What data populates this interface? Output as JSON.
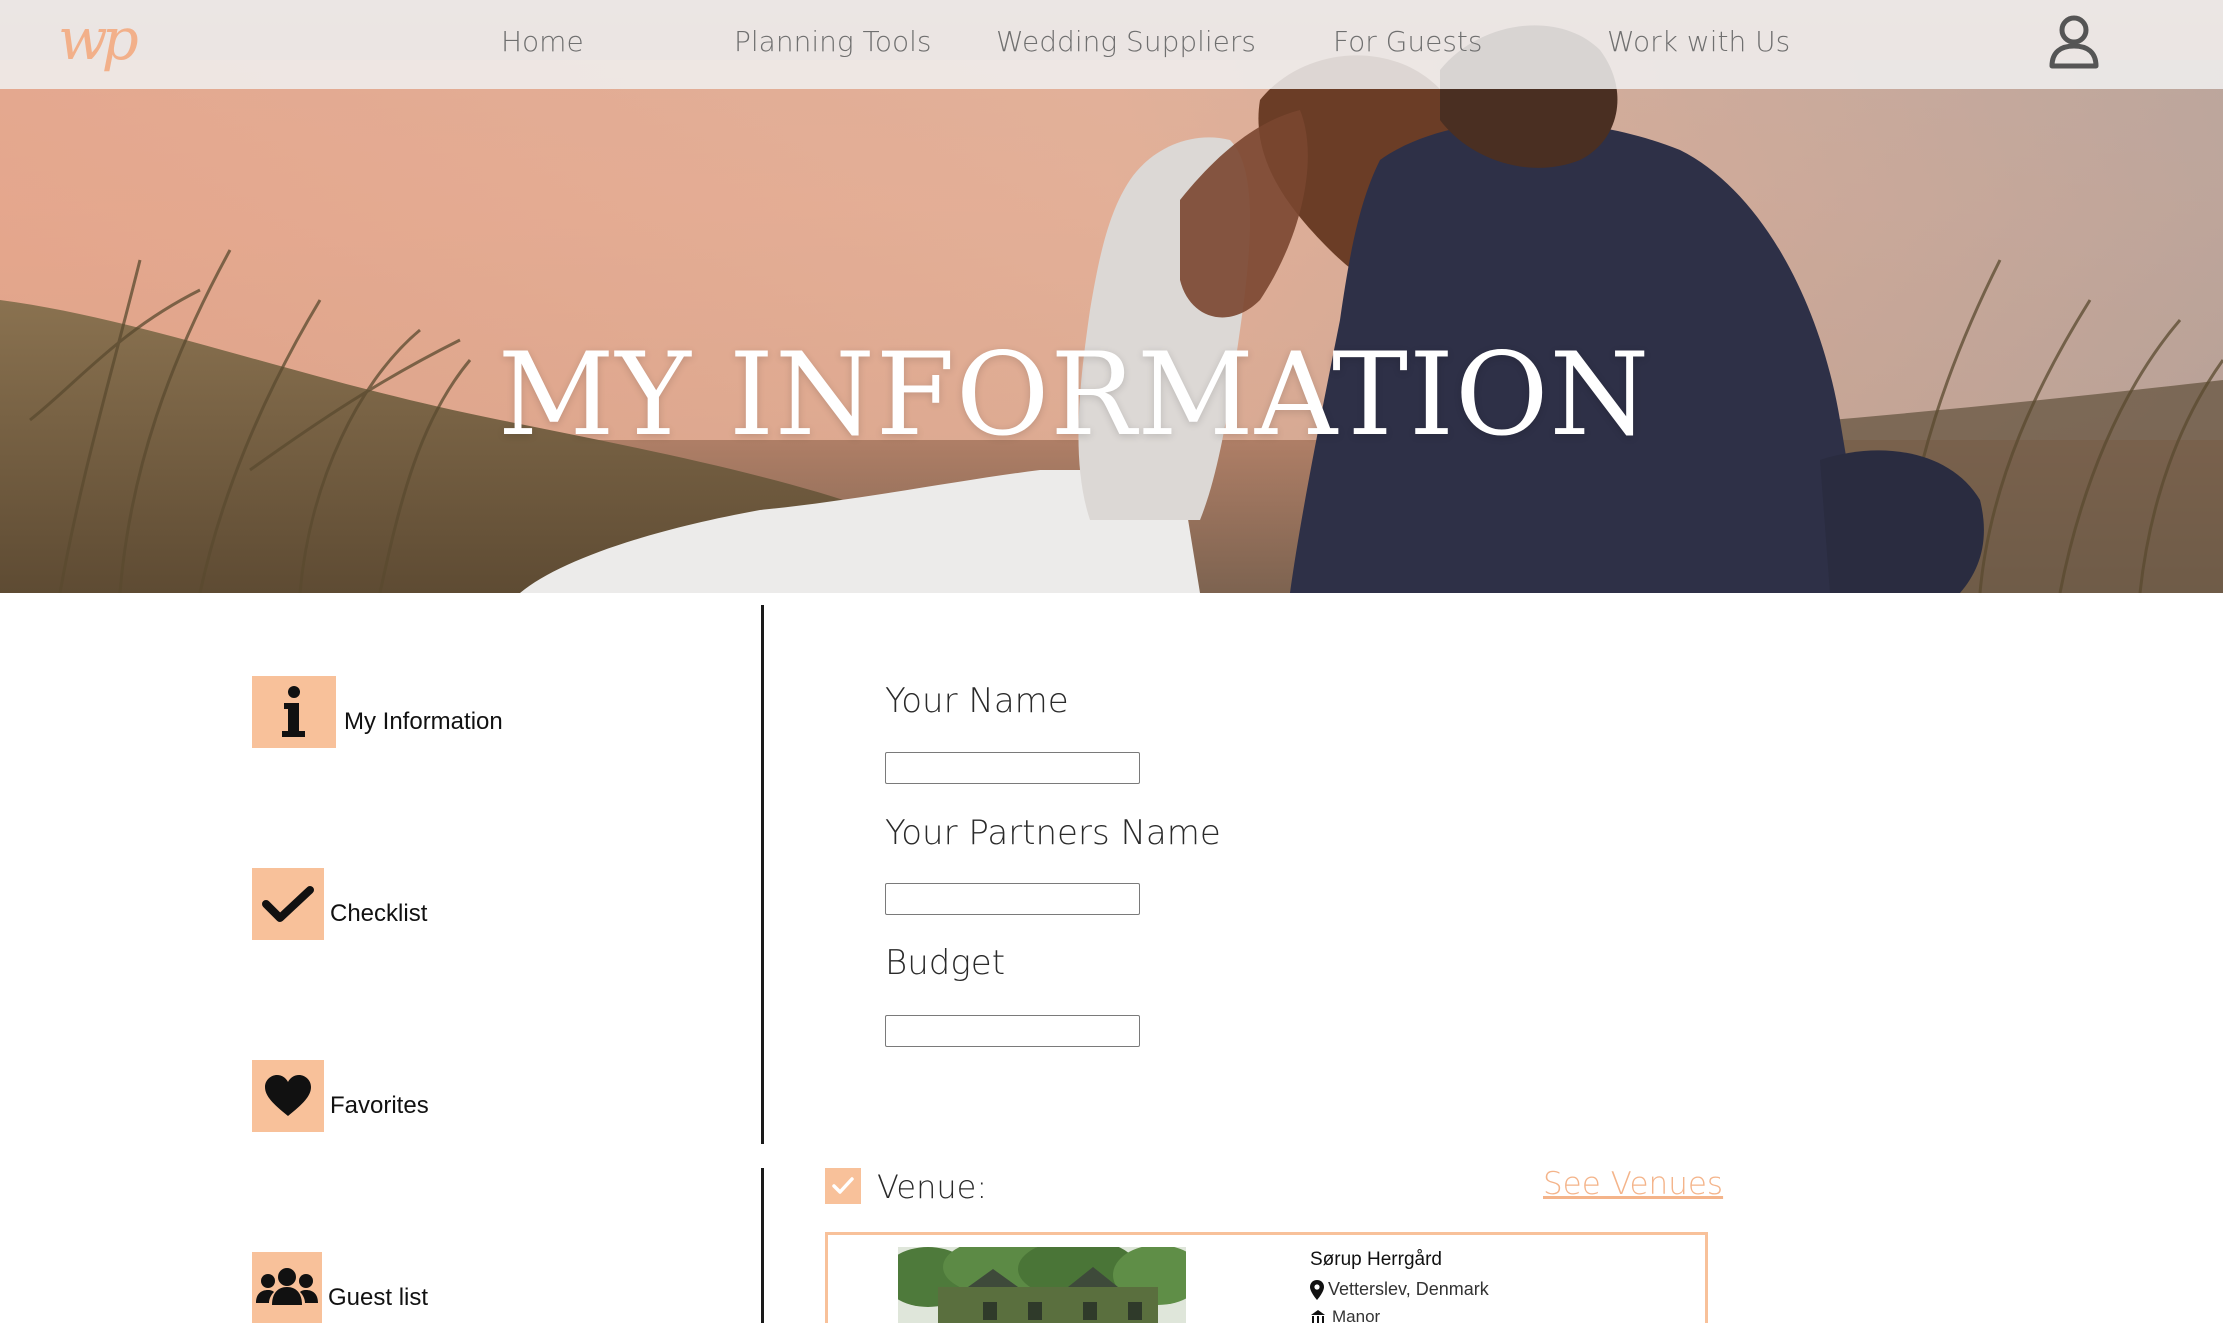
{
  "brand": {
    "logo_text": "wp",
    "accent_color": "#f8c19a"
  },
  "nav": {
    "items": [
      {
        "label": "Home"
      },
      {
        "label": "Planning Tools"
      },
      {
        "label": "Wedding Suppliers"
      },
      {
        "label": "For Guests"
      },
      {
        "label": "Work with Us"
      }
    ],
    "user_icon": "user-icon"
  },
  "hero": {
    "title": "MY INFORMATION"
  },
  "sidebar": {
    "items": [
      {
        "label": "My Information",
        "icon": "info-icon"
      },
      {
        "label": "Checklist",
        "icon": "checkmark-icon"
      },
      {
        "label": "Favorites",
        "icon": "heart-icon"
      },
      {
        "label": "Guest list",
        "icon": "people-icon"
      }
    ]
  },
  "form": {
    "name_label": "Your Name",
    "name_value": "",
    "partner_label": "Your Partners Name",
    "partner_value": "",
    "budget_label": "Budget",
    "budget_value": ""
  },
  "venue": {
    "label": "Venue:",
    "checked": true,
    "see_link": "See Venues",
    "card": {
      "name": "Sørup Herrgård",
      "location": "Vetterslev, Denmark",
      "type": "Manor"
    }
  }
}
